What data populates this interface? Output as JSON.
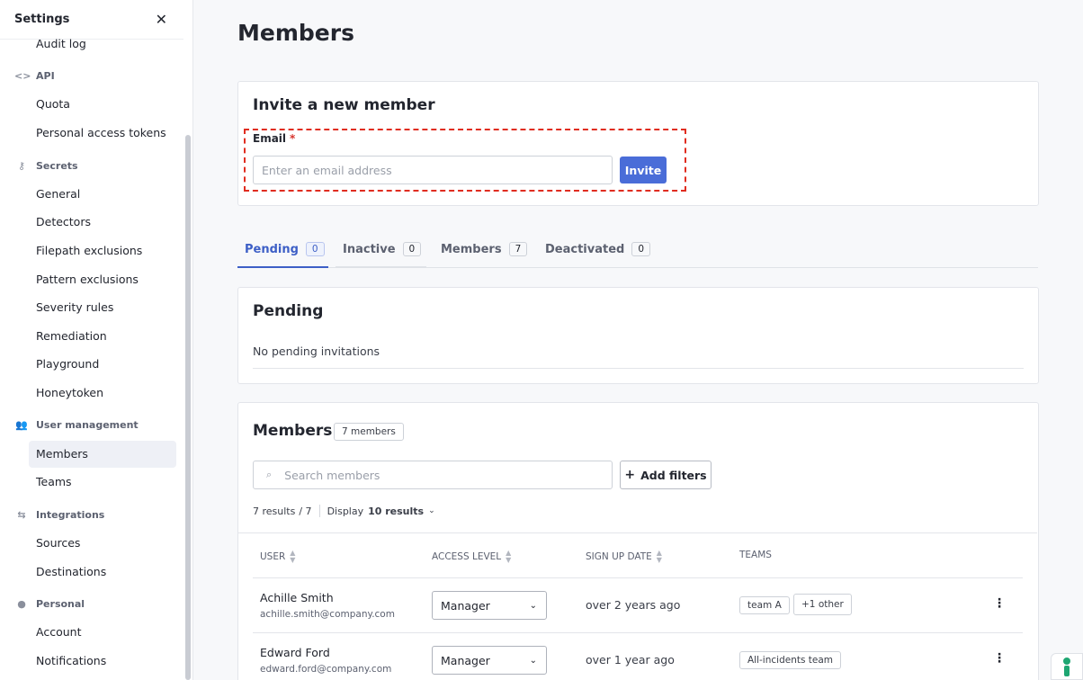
{
  "sidebar": {
    "title": "Settings",
    "items": {
      "audit_log": "Audit log",
      "api": "API",
      "quota": "Quota",
      "personal_access_tokens": "Personal access tokens",
      "secrets": "Secrets",
      "general": "General",
      "detectors": "Detectors",
      "filepath_exclusions": "Filepath exclusions",
      "pattern_exclusions": "Pattern exclusions",
      "severity_rules": "Severity rules",
      "remediation": "Remediation",
      "playground": "Playground",
      "honeytoken": "Honeytoken",
      "user_management": "User management",
      "members": "Members",
      "teams": "Teams",
      "integrations": "Integrations",
      "sources": "Sources",
      "destinations": "Destinations",
      "personal": "Personal",
      "account": "Account",
      "notifications": "Notifications"
    },
    "active": "Members"
  },
  "page": {
    "title": "Members"
  },
  "invite": {
    "title": "Invite a new member",
    "email_label": "Email",
    "required_mark": "*",
    "email_placeholder": "Enter an email address",
    "email_value": "",
    "button": "Invite"
  },
  "tabs": [
    {
      "label": "Pending",
      "count": "0",
      "active": true
    },
    {
      "label": "Inactive",
      "count": "0",
      "active": false
    },
    {
      "label": "Members",
      "count": "7",
      "active": false
    },
    {
      "label": "Deactivated",
      "count": "0",
      "active": false
    }
  ],
  "pending": {
    "title": "Pending",
    "empty_text": "No pending invitations"
  },
  "members": {
    "title": "Members",
    "count_badge": "7 members",
    "search_placeholder": "Search members",
    "add_filters": "Add filters",
    "results_text": "7 results",
    "results_total": "/ 7",
    "display_label": "Display",
    "display_value": "10 results",
    "columns": [
      "USER",
      "ACCESS LEVEL",
      "SIGN UP DATE",
      "TEAMS"
    ],
    "rows": [
      {
        "name": "Achille Smith",
        "email": "achille.smith@company.com",
        "access": "Manager",
        "signup": "over 2 years ago",
        "teams": [
          "team A",
          "+1 other"
        ]
      },
      {
        "name": "Edward Ford",
        "email": "edward.ford@company.com",
        "access": "Manager",
        "signup": "over 1 year ago",
        "teams": [
          "All-incidents team"
        ]
      }
    ]
  },
  "colors": {
    "accent": "#4a6dd8",
    "highlight_dashed": "#e02d20",
    "brand_green": "#1ea672"
  }
}
